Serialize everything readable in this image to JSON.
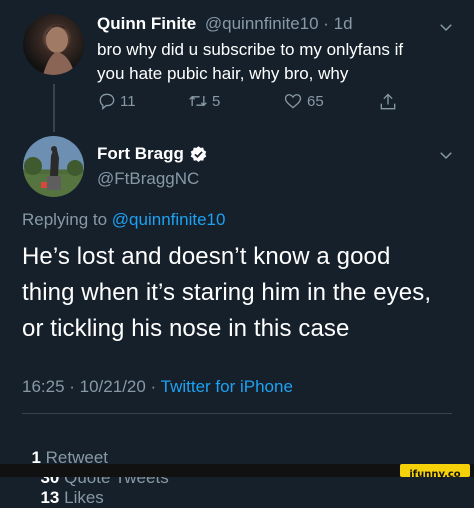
{
  "tweet1": {
    "display_name": "Quinn Finite",
    "handle_time": "@quinnfinite10 · 1d",
    "text_line1": "bro why did u subscribe to my onlyfans if",
    "text_line2": "you hate pubic hair, why bro, why",
    "replies": "11",
    "retweets": "5",
    "likes": "65"
  },
  "tweet2": {
    "display_name": "Fort Bragg",
    "handle": "@FtBraggNC",
    "replying_prefix": "Replying to",
    "replying_handle": "@quinnfinite10",
    "text_line1": "He’s lost and doesn’t know a good",
    "text_line2": "thing when it’s staring him in the eyes,",
    "text_line3": "or tickling his nose in this case",
    "time_date": "16:25 · 10/21/20 · ",
    "client": "Twitter for iPhone",
    "retweets_count": "1",
    "retweets_label": "Retweet",
    "quotes_count": "30",
    "quotes_label": "Quote Tweets",
    "likes_count": "13",
    "likes_label": "Likes"
  },
  "watermark": "ifunny.co",
  "colors": {
    "background": "#15202b",
    "muted": "#8899a6",
    "link": "#1da1f2",
    "divider": "#38444d"
  }
}
